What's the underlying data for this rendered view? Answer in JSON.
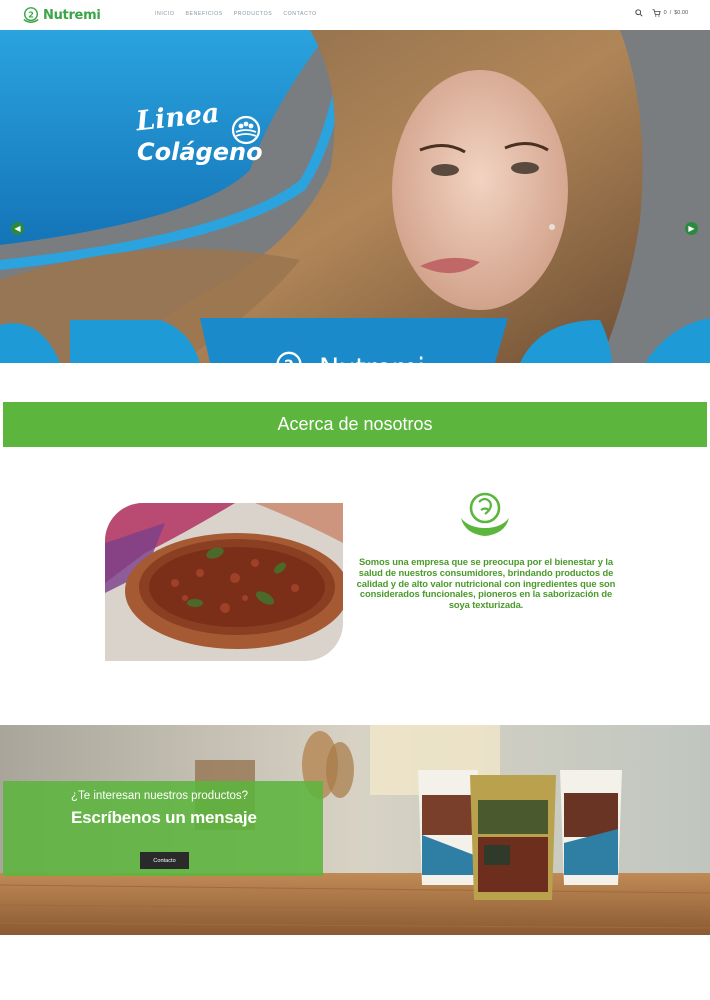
{
  "brand": {
    "name": "Nutremi",
    "registered": "®"
  },
  "nav": {
    "items": [
      "INICIO",
      "BENEFICIOS",
      "PRODUCTOS",
      "CONTACTO"
    ]
  },
  "cart": {
    "count": "0",
    "total": "$0.00"
  },
  "hero": {
    "title_line1": "Linea",
    "title_line2": "Colágeno",
    "brand_text": "Nutremi"
  },
  "about": {
    "heading": "Acerca de nosotros",
    "text": "Somos una empresa que se preocupa por el bienestar y la salud de nuestros consumidores, brindando productos de calidad y de alto valor nutricional con ingredientes que son considerados funcionales, pioneros en la saborización de soya texturizada."
  },
  "cta": {
    "question": "¿Te interesan nuestros productos?",
    "heading": "Escríbenos un mensaje",
    "button": "Contacto"
  },
  "colors": {
    "brand_green": "#5cb53d",
    "accent_blue": "#1e9ad6",
    "dark": "#2a2a2a"
  }
}
